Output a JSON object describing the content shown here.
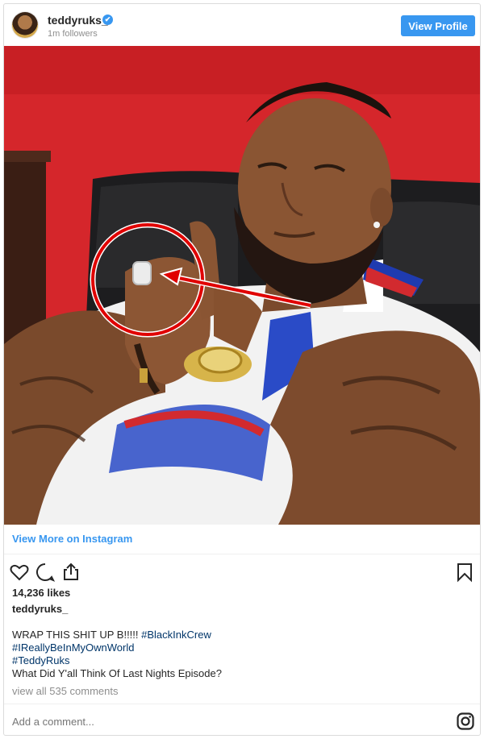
{
  "header": {
    "username": "teddyruks_",
    "verified_icon": "✔",
    "followers": "1m followers",
    "view_profile_label": "View Profile"
  },
  "photo": {
    "description_icon": "post-photo"
  },
  "links": {
    "view_more": "View More on Instagram"
  },
  "actions": {
    "like_icon": "heart-icon",
    "comment_icon": "comment-icon",
    "share_icon": "share-icon",
    "save_icon": "bookmark-icon"
  },
  "post": {
    "likes": "14,236 likes",
    "caption_user": "teddyruks_",
    "caption_text_1": "WRAP THIS SHIT UP B!!!!! ",
    "hashtag_1": "#BlackInkCrew",
    "hashtag_2": "#IReallyBeInMyOwnWorld",
    "hashtag_3": "#TeddyRuks",
    "caption_text_2": "What Did Y'all Think Of Last Nights Episode?",
    "view_comments": "view all 535 comments"
  },
  "comment": {
    "placeholder": "Add a comment..."
  },
  "colors": {
    "accent": "#3897f0",
    "wall_red": "#d5262b",
    "annotation_red": "#e00000"
  }
}
